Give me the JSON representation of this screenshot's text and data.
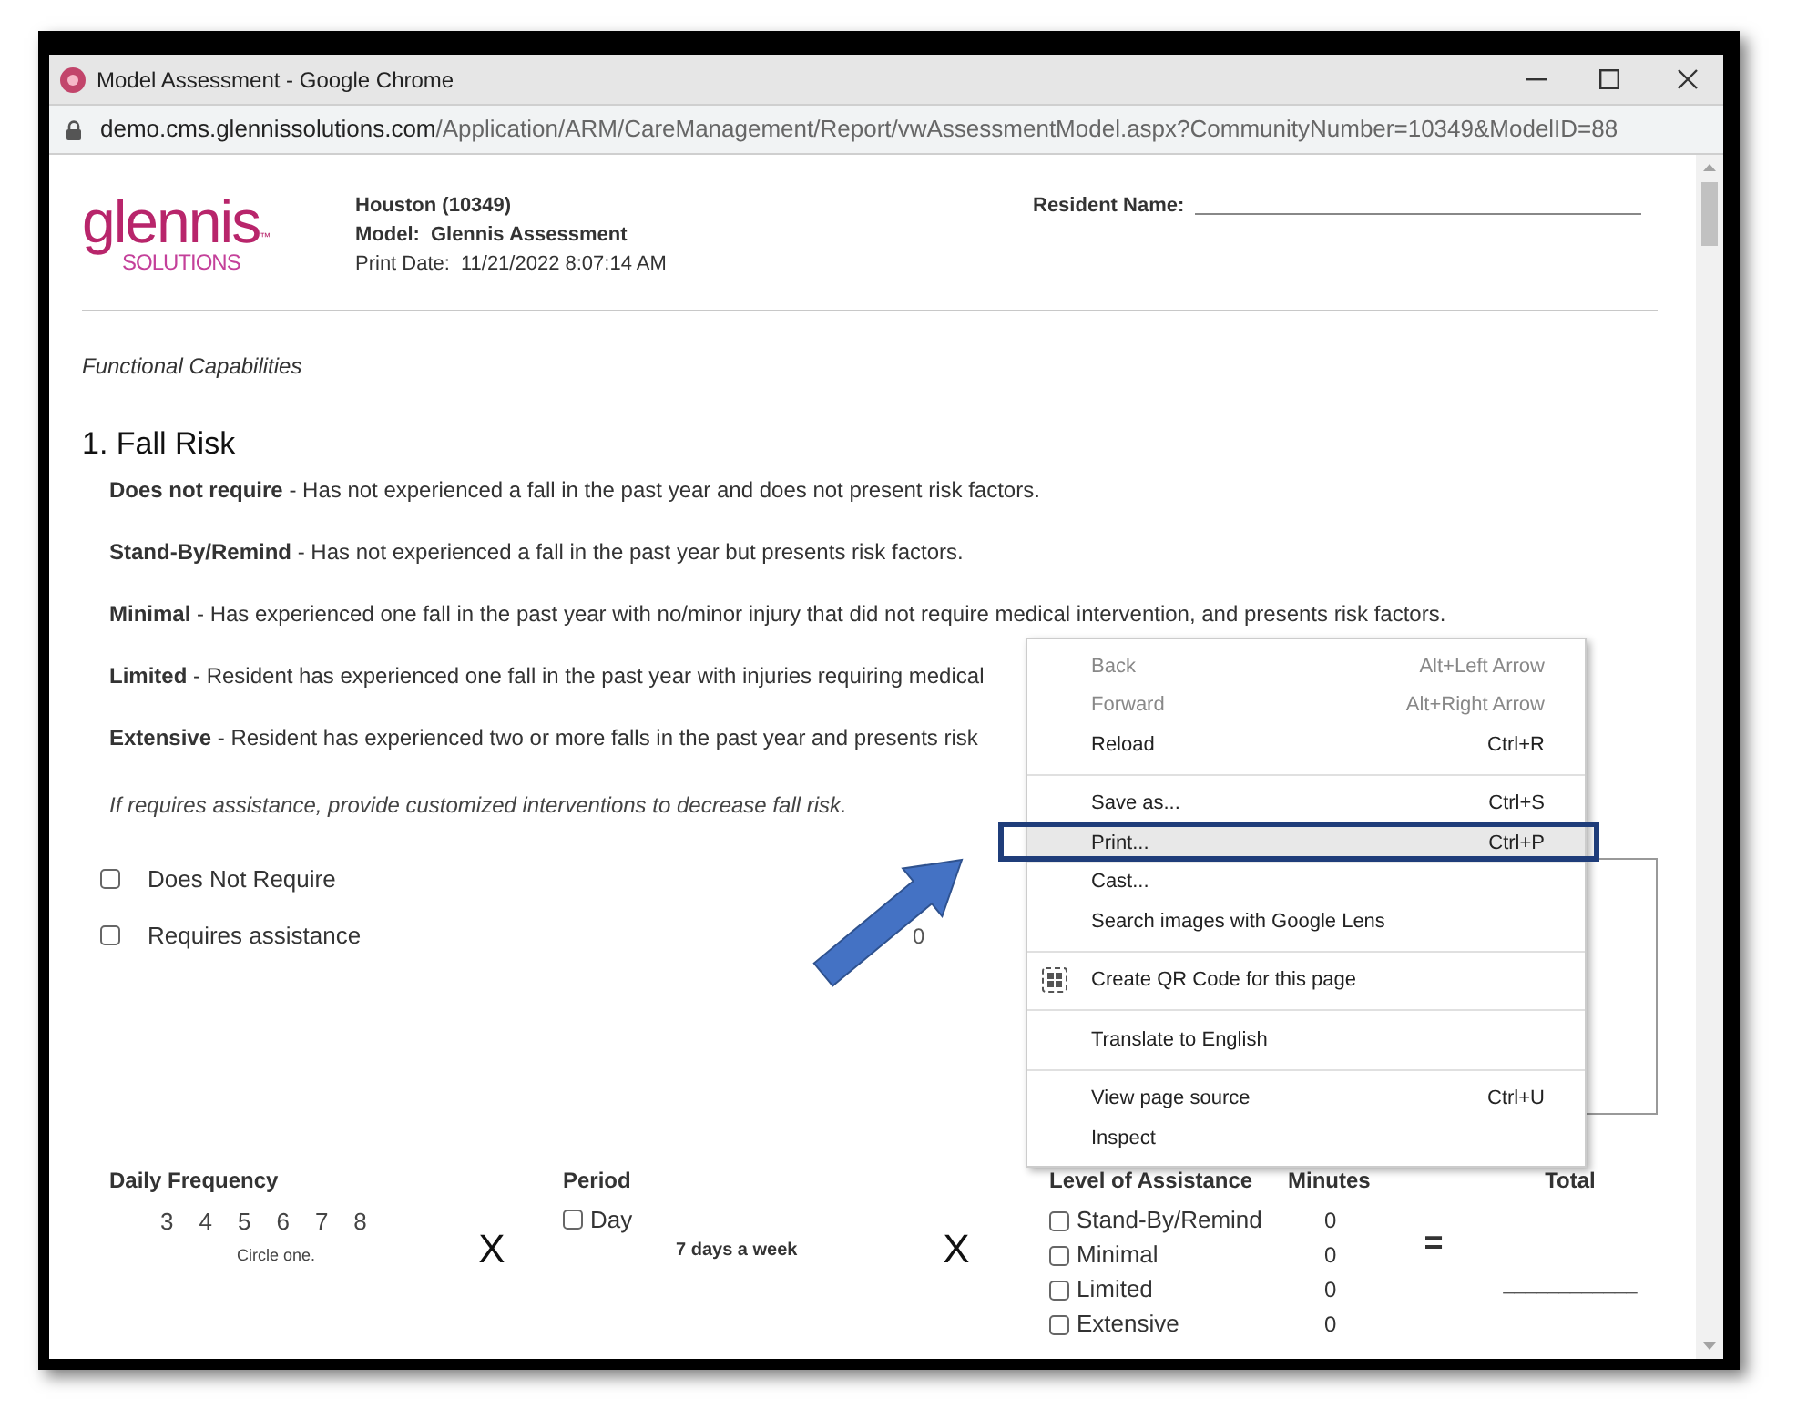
{
  "window": {
    "title": "Model Assessment - Google Chrome",
    "url_host": "demo.cms.glennissolutions.com",
    "url_path": "/Application/ARM/CareManagement/Report/vwAssessmentModel.aspx?CommunityNumber=10349&ModelID=88"
  },
  "logo": {
    "word": "glennis",
    "mark": "™",
    "tagline": "SOLUTIONS"
  },
  "header": {
    "location": "Houston (10349)",
    "model_label": "Model:",
    "model_value": "Glennis Assessment",
    "print_date_label": "Print Date:",
    "print_date_value": "11/21/2022 8:07:14 AM",
    "resident_label": "Resident Name:"
  },
  "section_title": "Functional Capabilities",
  "question": {
    "title": "1. Fall Risk",
    "levels": [
      "**Does not require** - Has not experienced a fall in the past year and does not present risk factors.",
      "**Stand-By/Remind** - Has not experienced a fall in the past year but presents risk factors.",
      "**Minimal** - Has experienced one fall in the past year with no/minor injury that did not require medical intervention, and presents risk factors.",
      "**Limited** - Resident has experienced one fall in the past year with injuries requiring medical",
      "**Extensive** - Resident has experienced two or more falls in the past year and presents risk"
    ],
    "note": "If requires assistance, provide customized interventions to decrease fall risk.",
    "options": [
      {
        "label": "Does Not Require",
        "checked": false
      },
      {
        "label": "Requires assistance",
        "checked": false,
        "points": "0"
      }
    ]
  },
  "frequency": {
    "heading": "Daily Frequency",
    "numbers": [
      "3",
      "4",
      "5",
      "6",
      "7",
      "8"
    ],
    "hint": "Circle one.",
    "operator": "X"
  },
  "period": {
    "heading": "Period",
    "options": [
      {
        "label": "Day",
        "checked": false
      }
    ],
    "text": "7 days a week",
    "operator": "X"
  },
  "assistance": {
    "heading": "Level of Assistance",
    "minutes_heading": "Minutes",
    "total_heading": "Total",
    "operator": "=",
    "total_blank": "____________",
    "rows": [
      {
        "label": "Stand-By/Remind",
        "minutes": "0",
        "checked": false
      },
      {
        "label": "Minimal",
        "minutes": "0",
        "checked": false
      },
      {
        "label": "Limited",
        "minutes": "0",
        "checked": false
      },
      {
        "label": "Extensive",
        "minutes": "0",
        "checked": false
      }
    ]
  },
  "context_menu": {
    "groups": [
      [
        {
          "label": "Back",
          "shortcut": "Alt+Left Arrow",
          "disabled": true,
          "selected": false
        },
        {
          "label": "Forward",
          "shortcut": "Alt+Right Arrow",
          "disabled": true,
          "selected": false
        },
        {
          "label": "Reload",
          "shortcut": "Ctrl+R",
          "disabled": false,
          "selected": false
        }
      ],
      [
        {
          "label": "Save as...",
          "shortcut": "Ctrl+S",
          "disabled": false,
          "selected": false
        },
        {
          "label": "Print...",
          "shortcut": "Ctrl+P",
          "disabled": false,
          "selected": true
        },
        {
          "label": "Cast...",
          "disabled": false,
          "selected": false
        },
        {
          "label": "Search images with Google Lens",
          "disabled": false,
          "selected": false
        }
      ],
      [
        {
          "label": "Create QR Code for this page",
          "kind": "qr",
          "disabled": false,
          "selected": false
        }
      ],
      [
        {
          "label": "Translate to English",
          "disabled": false,
          "selected": false
        }
      ],
      [
        {
          "label": "View page source",
          "shortcut": "Ctrl+U",
          "disabled": false,
          "selected": false
        },
        {
          "label": "Inspect",
          "disabled": false,
          "selected": false
        }
      ]
    ]
  }
}
